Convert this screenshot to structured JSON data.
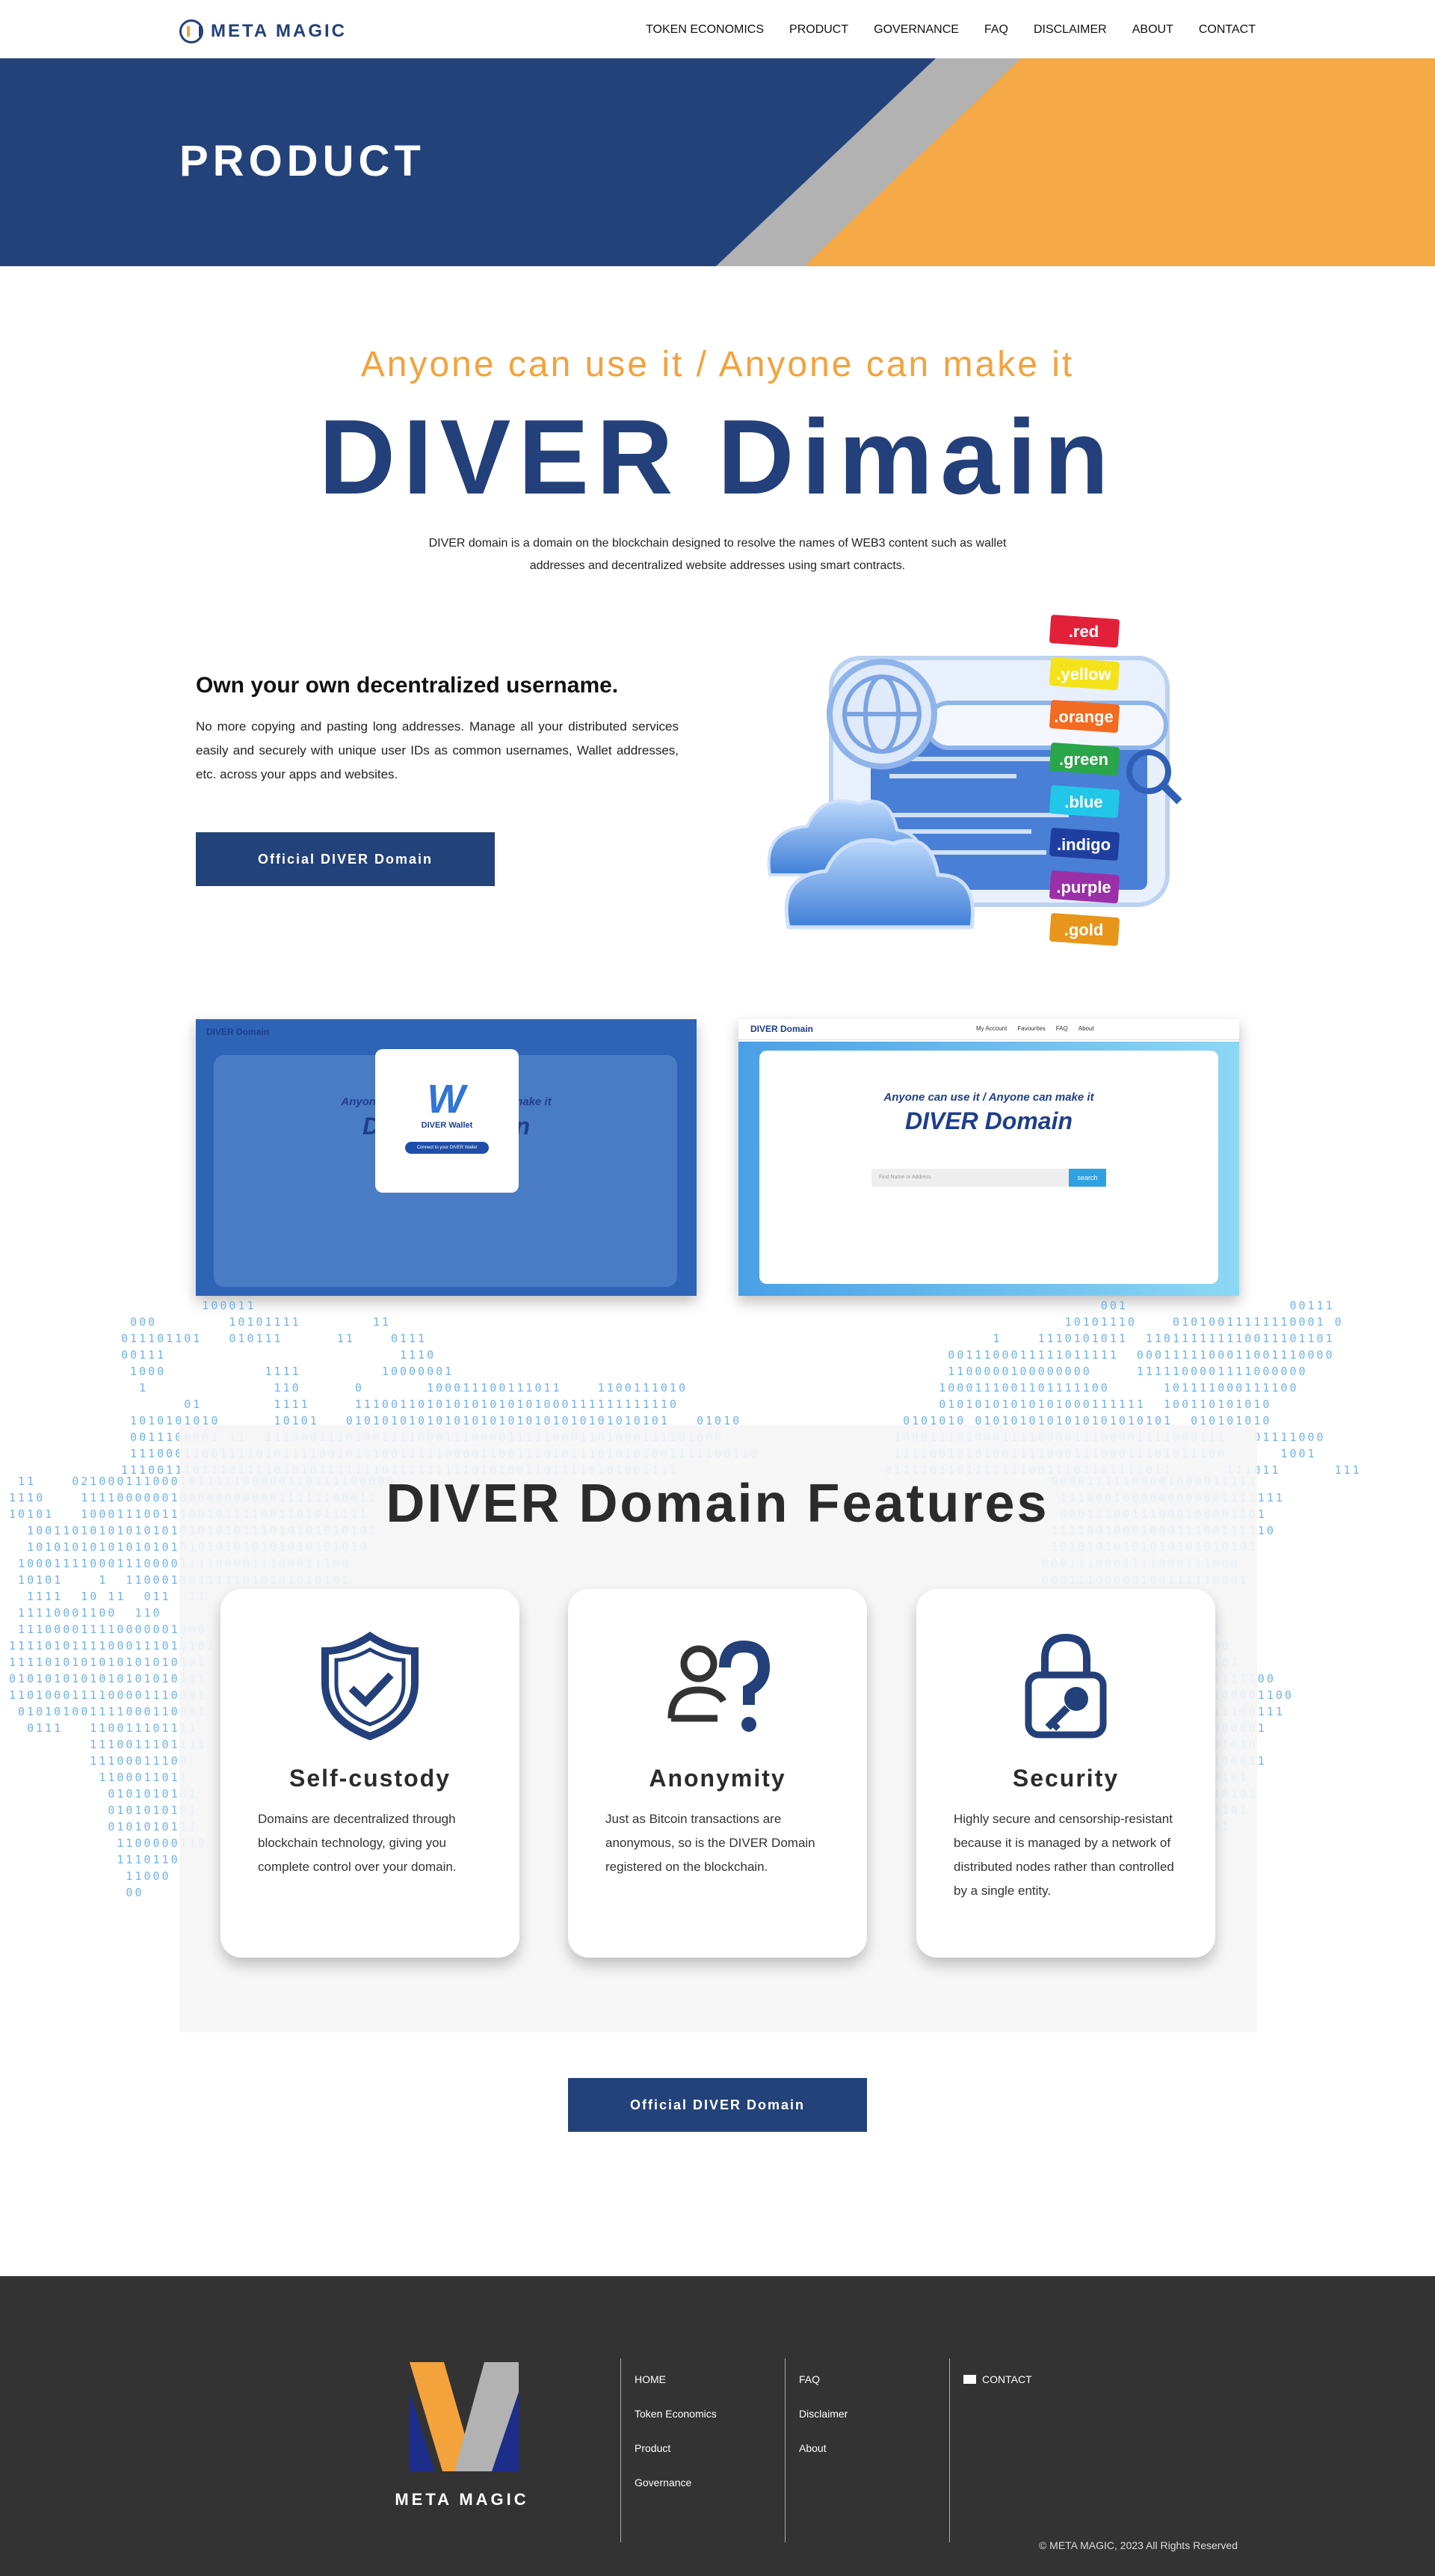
{
  "nav": {
    "brand": "META MAGIC",
    "items": [
      "TOKEN ECONOMICS",
      "PRODUCT",
      "GOVERNANCE",
      "FAQ",
      "DISCLAIMER",
      "ABOUT",
      "CONTACT"
    ]
  },
  "hero": {
    "title": "PRODUCT"
  },
  "intro": {
    "tagline": "Anyone can use it / Anyone can make it",
    "title": "DIVER Dimain",
    "text": "DIVER domain is a domain on the blockchain designed to resolve the names of WEB3 content such as wallet addresses and decentralized website addresses using smart contracts."
  },
  "username": {
    "title": "Own your own decentralized username.",
    "text": "No more copying and pasting long addresses. Manage all your distributed services easily and securely with unique user IDs as common usernames, Wallet addresses, etc. across your apps and websites.",
    "button": "Official DIVER Domain",
    "tags": [
      ".red",
      ".yellow",
      ".orange",
      ".green",
      ".blue",
      ".indigo",
      ".purple",
      ".gold"
    ]
  },
  "screenshots": {
    "left": {
      "logo": "DIVER Domain",
      "tagline": "Anyone can use it / Anyone can make it",
      "title": "DIVER Domain",
      "modal_title": "DIVER Wallet",
      "modal_button": "Connect to your DIVER Wallet"
    },
    "right": {
      "logo": "DIVER Domain",
      "nav": [
        "My Account",
        "Favourites",
        "FAQ",
        "About"
      ],
      "tagline": "Anyone can use it / Anyone can make it",
      "title": "DIVER Domain",
      "search_placeholder": "Find Name or Address",
      "search_button": "search"
    }
  },
  "features": {
    "title": "DIVER Domain Features",
    "cards": [
      {
        "title": "Self-custody",
        "text": "Domains are decentralized through blockchain technology, giving you complete control over your domain."
      },
      {
        "title": "Anonymity",
        "text": "Just as Bitcoin transactions are anonymous, so is the DIVER Domain registered on the blockchain."
      },
      {
        "title": "Security",
        "text": "Highly secure and censorship-resistant because it is managed by a network of distributed nodes rather than controlled by a single entity."
      }
    ],
    "button": "Official DIVER Domain"
  },
  "footer": {
    "brand": "META MAGIC",
    "col1": [
      "HOME",
      "Token Economics",
      "Product",
      "Governance"
    ],
    "col2": [
      "FAQ",
      "Disclaimer",
      "About"
    ],
    "contact": "CONTACT",
    "copyright": "© META MAGIC, 2023 All Rights Reserved"
  },
  "colors": {
    "navy": "#23427a",
    "orange": "#f4a23c",
    "gray": "#b2b2b2",
    "footer": "#333333"
  }
}
